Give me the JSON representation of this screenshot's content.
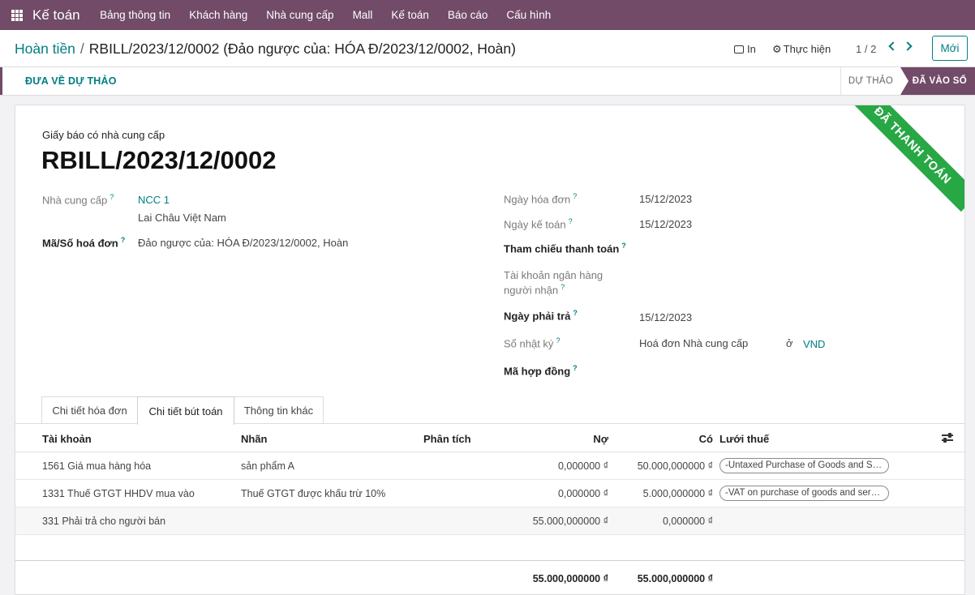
{
  "navbar": {
    "app_name": "Kế toán",
    "menu": [
      "Bảng thông tin",
      "Khách hàng",
      "Nhà cung cấp",
      "Mall",
      "Kế toán",
      "Báo cáo",
      "Cấu hình"
    ]
  },
  "control": {
    "breadcrumb_parent": "Hoàn tiền",
    "breadcrumb_separator": "/",
    "breadcrumb_current": "RBILL/2023/12/0002 (Đảo ngược của: HÓA Đ/2023/12/0002, Hoàn)",
    "print_label": "In",
    "action_label": "Thực hiện",
    "pager": "1 / 2",
    "new_label": "Mới"
  },
  "statusbar": {
    "reset_label": "ĐƯA VỀ DỰ THẢO",
    "stages": [
      "DỰ THẢO",
      "ĐÃ VÀO SỔ"
    ],
    "active_stage": "ĐÃ VÀO SỔ"
  },
  "form": {
    "ribbon": "ĐÃ THANH TOÁN",
    "doc_type": "Giấy báo có nhà cung cấp",
    "doc_name": "RBILL/2023/12/0002",
    "help_mark": "?",
    "vendor_label": "Nhà cung cấp",
    "vendor_name": "NCC 1",
    "vendor_address": "Lai Châu Việt Nam",
    "ref_label": "Mã/Số hoá đơn",
    "ref_value": "Đảo ngược của: HÓA Đ/2023/12/0002, Hoàn",
    "invoice_date_label": "Ngày hóa đơn",
    "invoice_date": "15/12/2023",
    "accounting_date_label": "Ngày kế toán",
    "accounting_date": "15/12/2023",
    "payment_ref_label": "Tham chiếu thanh toán",
    "bank_label_1": "Tài khoản ngân hàng",
    "bank_label_2": "người nhận",
    "due_date_label": "Ngày phải trả",
    "due_date": "15/12/2023",
    "journal_label": "Sổ nhật ký",
    "journal": "Hoá đơn Nhà cung cấp",
    "in_label": "ở",
    "currency": "VND",
    "contract_label": "Mã hợp đồng"
  },
  "tabs": [
    "Chi tiết hóa đơn",
    "Chi tiết bút toán",
    "Thông tin khác"
  ],
  "active_tab": "Chi tiết bút toán",
  "journal_items": {
    "columns": [
      "Tài khoản",
      "Nhãn",
      "Phân tích",
      "Nợ",
      "Có",
      "Lưới thuế"
    ],
    "rows": [
      {
        "account": "1561 Giá mua hàng hóa",
        "label": "sản phẩm A",
        "debit": "0,000000 ₫",
        "credit": "50.000,000000 ₫",
        "tax_grid": "-Untaxed Purchase of Goods and Services"
      },
      {
        "account": "1331 Thuế GTGT HHDV mua vào",
        "label": "Thuế GTGT được khấu trừ 10%",
        "debit": "0,000000 ₫",
        "credit": "5.000,000000 ₫",
        "tax_grid": "-VAT on purchase of goods and services"
      },
      {
        "account": "331 Phải trả cho người bán",
        "label": "",
        "debit": "55.000,000000 ₫",
        "credit": "0,000000 ₫",
        "tax_grid": ""
      }
    ],
    "total_debit": "55.000,000000 ₫",
    "total_credit": "55.000,000000 ₫"
  }
}
